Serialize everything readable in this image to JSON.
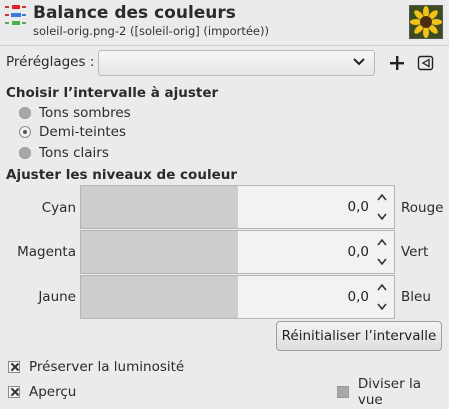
{
  "header": {
    "title": "Balance des couleurs",
    "subtitle": "soleil-orig.png-2 ([soleil-orig] (importée))",
    "icon": "color-balance-icon",
    "thumbnail": "sunflower-thumbnail"
  },
  "presets": {
    "label": "Préréglages :",
    "value": "",
    "add_icon": "plus-icon",
    "menu_icon": "menu-triangle-icon"
  },
  "range": {
    "title": "Choisir l’intervalle à ajuster",
    "options": [
      {
        "label": "Tons sombres",
        "selected": false
      },
      {
        "label": "Demi-teintes",
        "selected": true
      },
      {
        "label": "Tons clairs",
        "selected": false
      }
    ]
  },
  "levels": {
    "title": "Ajuster les niveaux de couleur",
    "sliders": [
      {
        "left": "Cyan",
        "right": "Rouge",
        "value": "0,0",
        "fraction": 0.5
      },
      {
        "left": "Magenta",
        "right": "Vert",
        "value": "0,0",
        "fraction": 0.5
      },
      {
        "left": "Jaune",
        "right": "Bleu",
        "value": "0,0",
        "fraction": 0.5
      }
    ]
  },
  "reset_label": "Réinitialiser l’intervalle",
  "preserve": {
    "label": "Préserver la luminosité",
    "checked": true
  },
  "preview": {
    "label": "Aperçu",
    "checked": true
  },
  "split": {
    "label": "Diviser la vue",
    "checked": false
  }
}
